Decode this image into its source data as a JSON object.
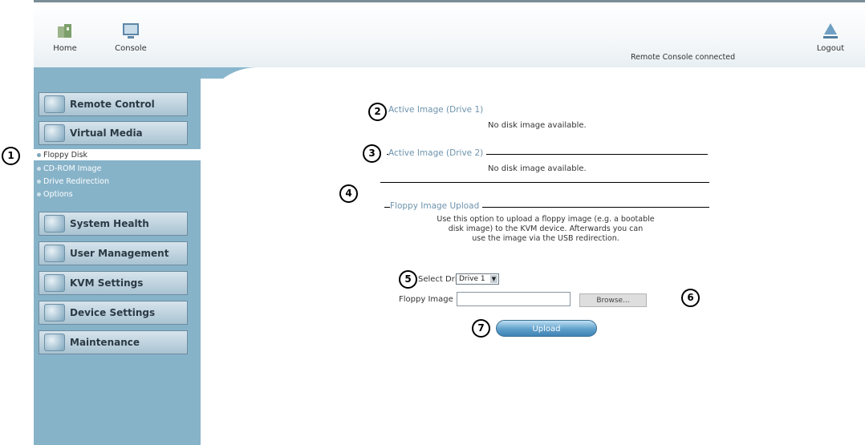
{
  "topnav": {
    "home_label": "Home",
    "console_label": "Console",
    "logout_label": "Logout",
    "status_text": "Remote Console connected"
  },
  "sidebar": {
    "groups": [
      {
        "label": "Remote Control",
        "icon": "monitor-icon"
      },
      {
        "label": "Virtual Media",
        "icon": "disc-icon"
      },
      {
        "label": "System Health",
        "icon": "health-icon"
      },
      {
        "label": "User Management",
        "icon": "users-icon"
      },
      {
        "label": "KVM Settings",
        "icon": "kvm-icon"
      },
      {
        "label": "Device Settings",
        "icon": "device-icon"
      },
      {
        "label": "Maintenance",
        "icon": "maintenance-icon"
      }
    ],
    "virtual_media_items": [
      {
        "label": "Floppy Disk",
        "active": true
      },
      {
        "label": "CD-ROM Image",
        "active": false
      },
      {
        "label": "Drive Redirection",
        "active": false
      },
      {
        "label": "Options",
        "active": false
      }
    ]
  },
  "content": {
    "drive1_title": "Active Image (Drive 1)",
    "drive1_status": "No disk image available.",
    "drive2_title": "Active Image (Drive 2)",
    "drive2_status": "No disk image available.",
    "upload_title": "Floppy Image Upload",
    "upload_description_lines": [
      "Use this option to upload a floppy image (e.g. a bootable",
      "disk image) to the KVM device. Afterwards you can",
      "use the image via the USB redirection."
    ],
    "select_drive_label": "Select Drive",
    "select_drive_value": "Drive 1",
    "floppy_image_label": "Floppy Image File",
    "file_input_value": "",
    "browse_label": "Browse...",
    "upload_label": "Upload"
  },
  "callouts": [
    "1",
    "2",
    "3",
    "4",
    "5",
    "6",
    "7"
  ],
  "colors": {
    "sidebar_bg": "#87b3c9",
    "section_title": "#6d93ad",
    "upload_button": "#5e9fc9"
  }
}
